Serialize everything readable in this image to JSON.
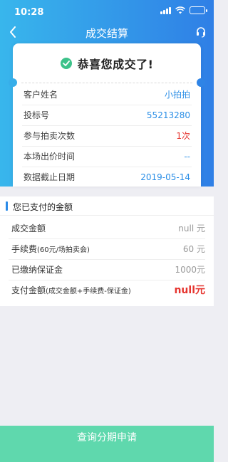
{
  "status_bar": {
    "time": "10:28"
  },
  "nav": {
    "title": "成交结算",
    "back_icon": "chevron-left-icon",
    "service_icon": "headset-icon"
  },
  "card": {
    "title": "恭喜您成交了!",
    "rows": [
      {
        "label": "客户姓名",
        "value": "小拍拍",
        "color": "#2a8ee6"
      },
      {
        "label": "投标号",
        "value": "55213280",
        "color": "#2a8ee6"
      },
      {
        "label": "参与拍卖次数",
        "value": "1次",
        "color": "#e6352f"
      },
      {
        "label": "本场出价时间",
        "value": "--",
        "color": "#2a8ee6"
      },
      {
        "label": "数据截止日期",
        "value": "2019-05-14",
        "color": "#2a8ee6"
      }
    ]
  },
  "payment": {
    "title": "您已支付的金额",
    "rows": [
      {
        "label": "成交金额",
        "note": "",
        "value": "null 元"
      },
      {
        "label": "手续费",
        "note": "(60元/场拍卖会)",
        "value": "60 元"
      },
      {
        "label": "已缴纳保证金",
        "note": "",
        "value": "1000元"
      }
    ],
    "total": {
      "label": "支付金额",
      "note": "(成交金额+手续费-保证金)",
      "value": "null元"
    }
  },
  "bottom_button": {
    "label": "查询分期申请"
  },
  "colors": {
    "accent": "#2b8be8",
    "highlight": "#e6352f",
    "success": "#3dc28a",
    "button": "#5fd8ad"
  }
}
